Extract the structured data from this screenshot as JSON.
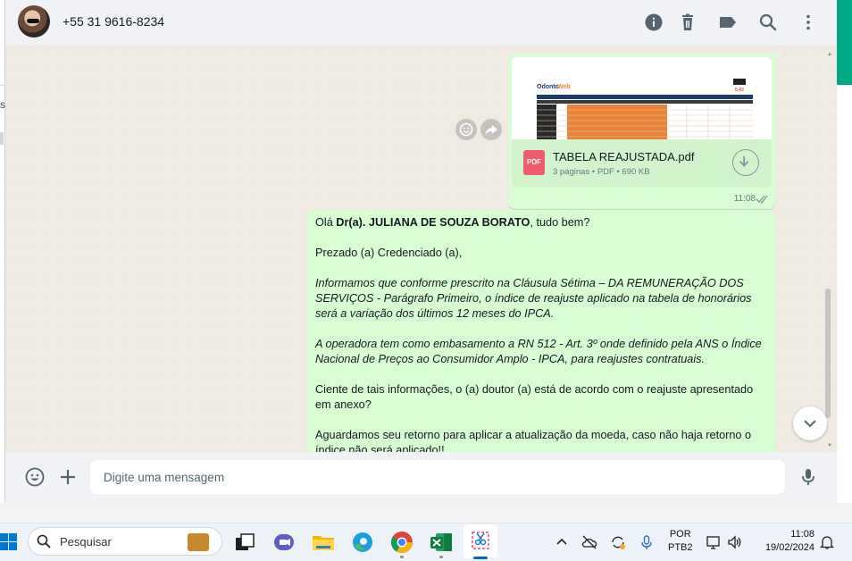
{
  "header": {
    "contact": "+55 31 9616-8234",
    "icons": [
      "info-icon",
      "trash-icon",
      "label-icon",
      "search-icon",
      "menu-icon"
    ]
  },
  "left_strip_char": "s",
  "pdf_message": {
    "file_name": "TABELA REAJUSTADA.pdf",
    "file_type": "PDF",
    "pages": "3 páginas",
    "type": "PDF",
    "size": "690 KB",
    "time": "11:08",
    "thumbnail": {
      "logo": "Odonto",
      "logo_suffix": "Web",
      "badge": "5,43"
    }
  },
  "text_message": {
    "greeting_pre": "Olá ",
    "greeting_name": "Dr(a). JULIANA DE SOUZA BORATO",
    "greeting_post": ", tudo bem?",
    "p1": "Prezado (a) Credenciado (a),",
    "p2": "Informamos que conforme prescrito na Cláusula Sétima – DA REMUNERAÇÃO DOS SERVIÇOS - Parágrafo Primeiro, o índice de reajuste aplicado na tabela de honorários será a variação dos últimos 12 meses do IPCA.",
    "p3": "A operadora tem como embasamento a RN 512 - Art. 3º onde definido pela ANS o Índice Nacional de Preços ao Consumidor Amplo - IPCA, para reajustes contratuais.",
    "p4": "Ciente de tais informações, o (a) doutor (a) está de acordo com o reajuste apresentado em anexo?",
    "p5": "Aguardamos seu retorno para aplicar a atualização da moeda, caso não haja retorno o índice não será aplicado!!"
  },
  "composer": {
    "placeholder": "Digite uma mensagem"
  },
  "taskbar": {
    "search_label": "Pesquisar",
    "lang_line1": "POR",
    "lang_line2": "PTB2",
    "time": "11:08",
    "date": "19/02/2024"
  },
  "colors": {
    "bubble_out": "#d9fdd3",
    "chat_bg": "#efeae2",
    "accent": "#00a884",
    "pdf_red": "#f15c6d",
    "thumb_orange": "#e8833a"
  }
}
